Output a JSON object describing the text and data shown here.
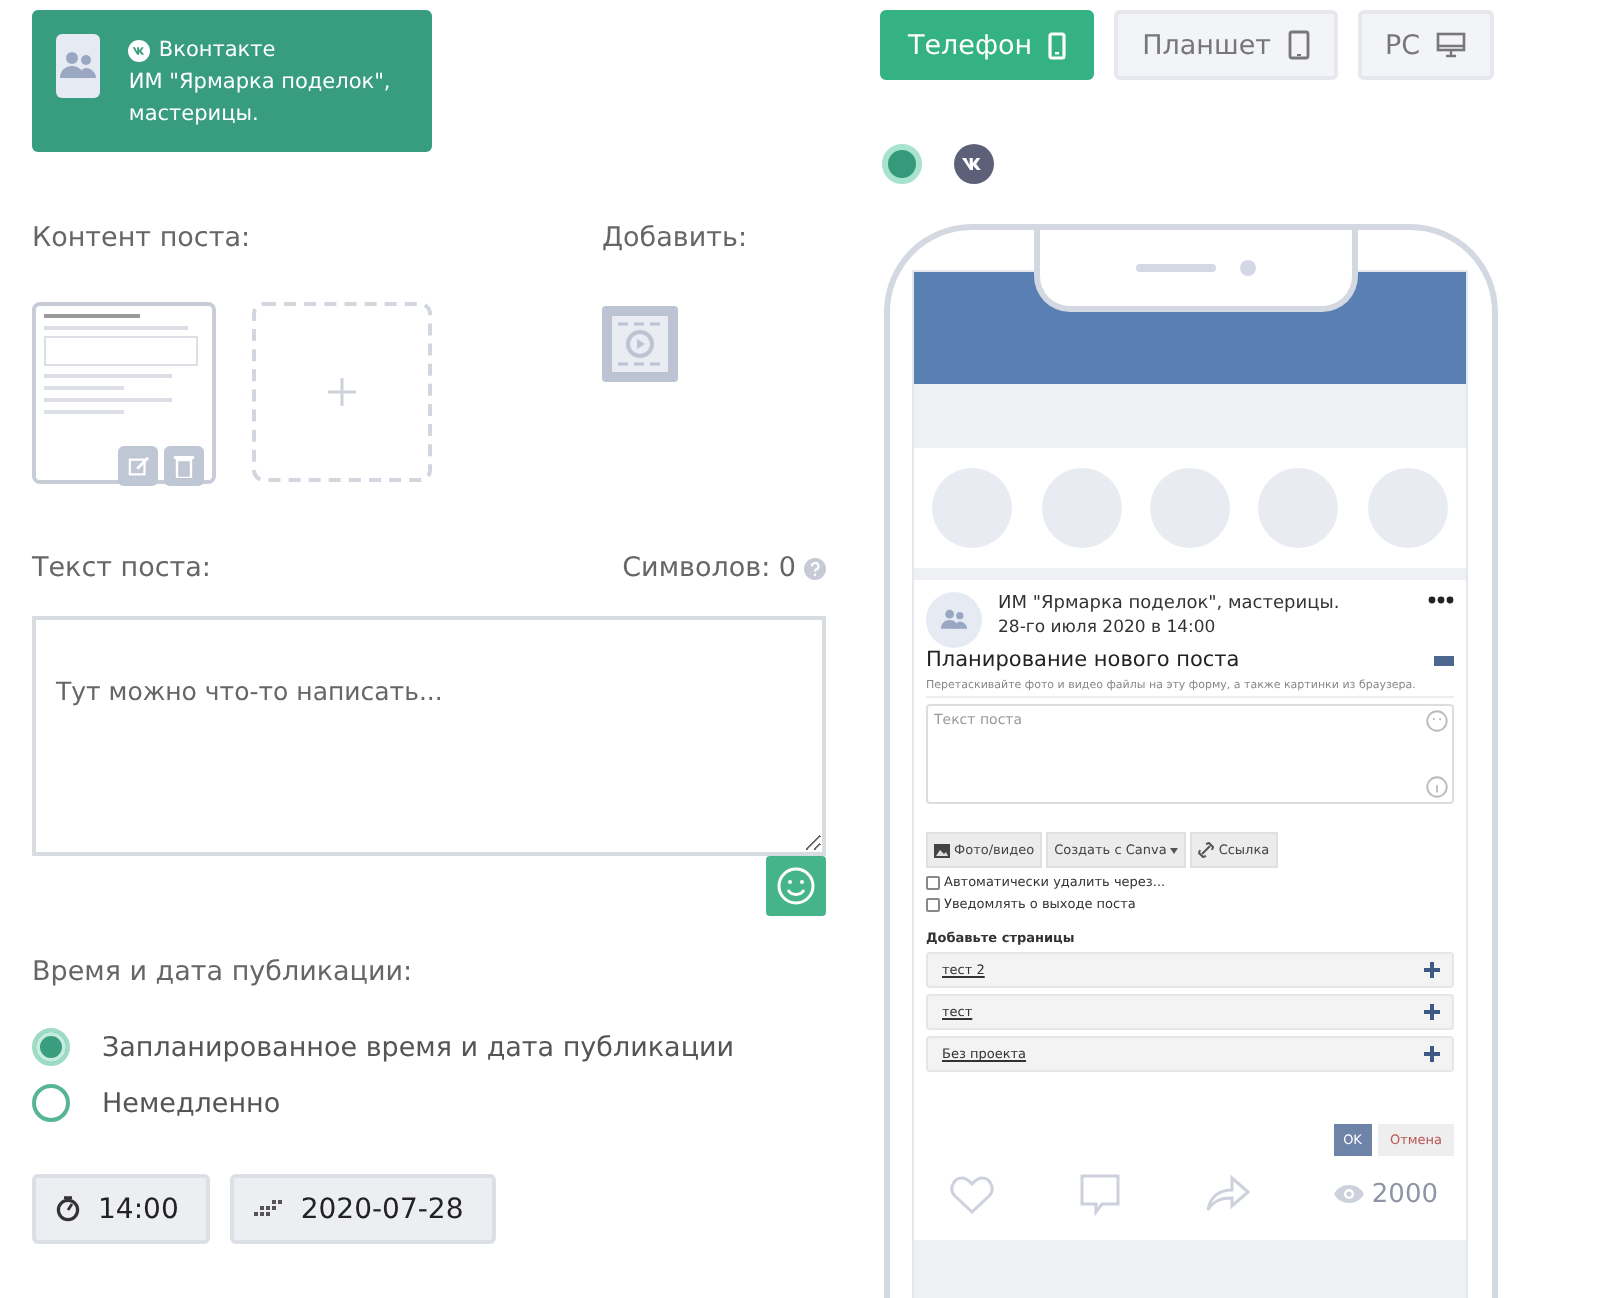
{
  "account_card": {
    "network": "Вконтакте",
    "name": "ИМ \"Ярмарка поделок\", мастерицы."
  },
  "content": {
    "label": "Контент поста:",
    "add_label": "Добавить:"
  },
  "post_text": {
    "label": "Текст поста:",
    "counter": "Символов: 0",
    "placeholder": "Тут можно что-то написать..."
  },
  "schedule": {
    "label": "Время и дата публикации:",
    "time": "14:00",
    "date": "2020-07-28",
    "options": [
      {
        "label": "Запланированное время и дата публикации",
        "selected": true
      },
      {
        "label": "Немедленно",
        "selected": false
      }
    ]
  },
  "devices": [
    {
      "label": "Телефон",
      "kind": "phone",
      "selected": true
    },
    {
      "label": "Планшет",
      "kind": "tablet",
      "selected": false
    },
    {
      "label": "PC",
      "kind": "desktop",
      "selected": false
    }
  ],
  "networks": [
    {
      "kind": "all",
      "selected": true
    },
    {
      "kind": "vk",
      "selected": false
    }
  ],
  "preview": {
    "author": "ИМ \"Ярмарка поделок\", мастерицы.",
    "date": "28-го июля 2020 в 14:00",
    "title": "Планирование нового поста",
    "hint": "Перетаскивайте фото и видео файлы на эту форму, а также картинки из браузера.",
    "placeholder": "Текст поста",
    "tools": [
      {
        "label": "Фото/видео",
        "kind": "photo"
      },
      {
        "label": "Создать с Canva",
        "kind": "dropdown"
      },
      {
        "label": "Ссылка",
        "kind": "link"
      }
    ],
    "checkboxes": [
      {
        "label": "Автоматически удалить через...",
        "checked": false
      },
      {
        "label": "Уведомлять о выходе поста",
        "checked": false
      }
    ],
    "pages_label": "Добавьте страницы",
    "pages": [
      "тест 2",
      "тест",
      "Без проекта"
    ],
    "ok": "OK",
    "cancel": "Отмена",
    "views": "2000"
  }
}
